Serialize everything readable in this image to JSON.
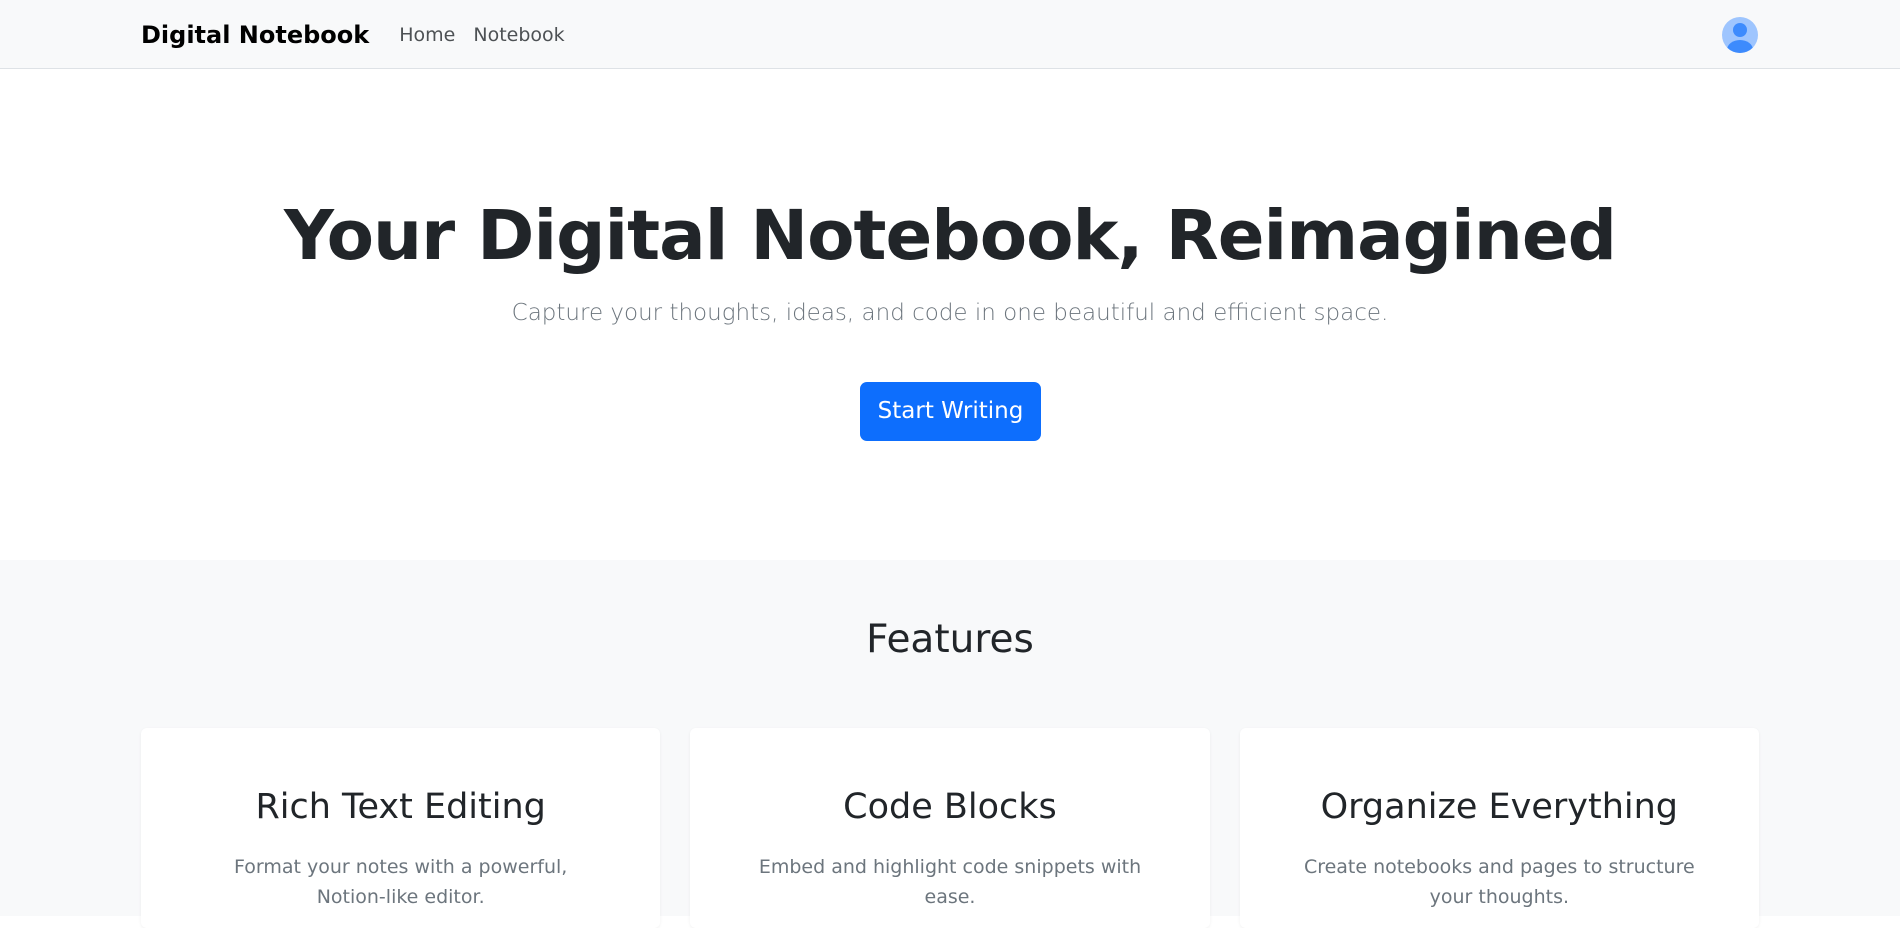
{
  "navbar": {
    "brand": "Digital Notebook",
    "links": [
      {
        "label": "Home"
      },
      {
        "label": "Notebook"
      }
    ],
    "avatar_icon": "user-circle-icon"
  },
  "hero": {
    "title": "Your Digital Notebook, Reimagined",
    "subtitle": "Capture your thoughts, ideas, and code in one beautiful and efficient space.",
    "cta_label": "Start Writing"
  },
  "features": {
    "heading": "Features",
    "cards": [
      {
        "title": "Rich Text Editing",
        "text": "Format your notes with a powerful, Notion-like editor."
      },
      {
        "title": "Code Blocks",
        "text": "Embed and highlight code snippets with ease."
      },
      {
        "title": "Organize Everything",
        "text": "Create notebooks and pages to structure your thoughts."
      }
    ]
  },
  "colors": {
    "primary": "#0d6efd",
    "navbar_bg": "#f8f9fa",
    "text_dark": "#212529",
    "text_muted": "#6c757d",
    "avatar_bg": "#9ec5fe",
    "avatar_fg": "#3d8bfd"
  }
}
